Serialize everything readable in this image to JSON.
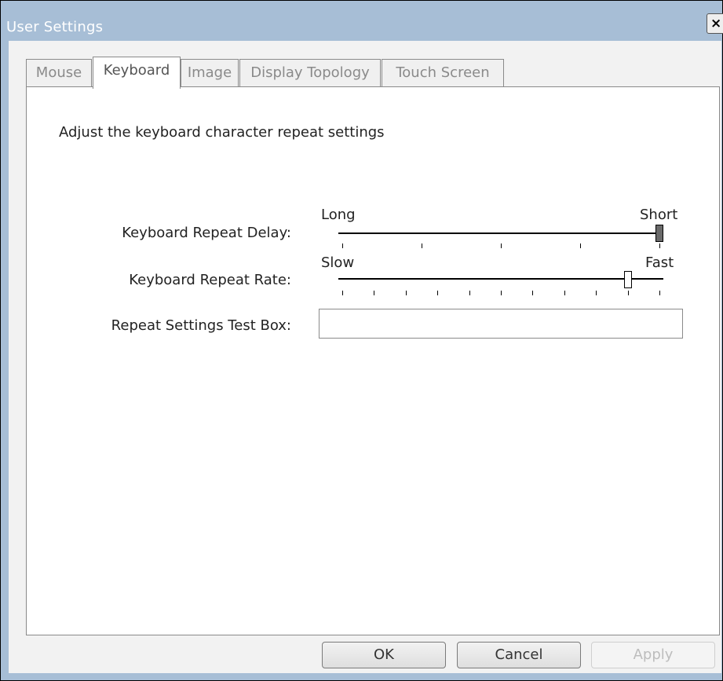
{
  "window": {
    "title": "User Settings",
    "close_label": "×"
  },
  "tabs": [
    {
      "label": "Mouse",
      "active": false
    },
    {
      "label": "Keyboard",
      "active": true
    },
    {
      "label": "Image",
      "active": false
    },
    {
      "label": "Display Topology",
      "active": false
    },
    {
      "label": "Touch Screen",
      "active": false
    }
  ],
  "keyboard": {
    "description": "Adjust the keyboard character repeat settings",
    "repeat_delay": {
      "label": "Keyboard Repeat Delay:",
      "min_label": "Long",
      "max_label": "Short",
      "steps": 5,
      "value_index": 4
    },
    "repeat_rate": {
      "label": "Keyboard Repeat Rate:",
      "min_label": "Slow",
      "max_label": "Fast",
      "steps": 11,
      "value_index": 9
    },
    "test_box": {
      "label": "Repeat Settings Test Box:",
      "value": ""
    }
  },
  "buttons": {
    "ok": "OK",
    "cancel": "Cancel",
    "apply": "Apply"
  },
  "colors": {
    "titlebar": "#a7bed6",
    "panel": "#ffffff",
    "window_bg": "#f2f2f2"
  }
}
